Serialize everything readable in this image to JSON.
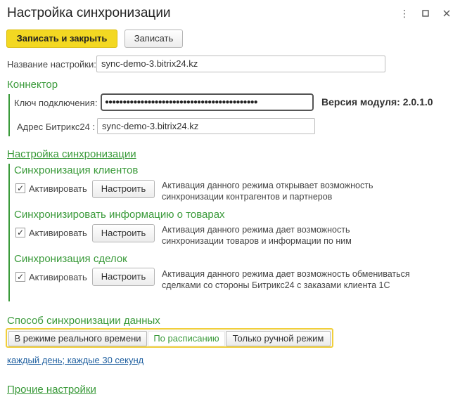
{
  "window": {
    "title": "Настройка синхронизации",
    "menu_icon": "more-vertical-icon",
    "maximize_icon": "maximize-icon",
    "close_icon": "close-icon"
  },
  "toolbar": {
    "save_close_label": "Записать и закрыть",
    "save_label": "Записать"
  },
  "settings_name": {
    "label": "Название настройки:",
    "value": "sync-demo-3.bitrix24.kz"
  },
  "connector": {
    "heading": "Коннектор",
    "key_label": "Ключ подключения:",
    "key_value": "●●●●●●●●●●●●●●●●●●●●●●●●●●●●●●●●●●●●●●●●●●●",
    "module_version": "Версия модуля: 2.0.1.0",
    "address_label": "Адрес Битрикс24 :",
    "address_value": "sync-demo-3.bitrix24.kz"
  },
  "sync_settings": {
    "heading": "Настройка синхронизации",
    "blocks": [
      {
        "title": "Синхронизация клиентов",
        "checkbox_label": "Активировать",
        "checked": true,
        "button_label": "Настроить",
        "desc_line1": "Активация данного режима открывает возможность",
        "desc_line2": "синхронизации контрагентов и партнеров"
      },
      {
        "title": "Синхронизировать информацию о товарах",
        "checkbox_label": "Активировать",
        "checked": true,
        "button_label": "Настроить",
        "desc_line1": "Активация данного режима дает возможность",
        "desc_line2": "синхронизации товаров и информации по ним"
      },
      {
        "title": "Синхронизация сделок",
        "checkbox_label": "Активировать",
        "checked": true,
        "button_label": "Настроить",
        "desc_line1": "Активация данного режима дает возможность обмениваться",
        "desc_line2": "сделками со стороны Битрикс24 с заказами клиента 1С"
      }
    ]
  },
  "sync_method": {
    "heading": "Способ синхронизации данных",
    "options": [
      "В режиме реального времени",
      "По расписанию",
      "Только ручной режим"
    ],
    "selected": "По расписанию",
    "schedule_link": "каждый день; каждые 30 секунд"
  },
  "other": {
    "heading": "Прочие настройки"
  },
  "colors": {
    "accent_green": "#3a9a3a",
    "primary_yellow": "#f3d822",
    "link_blue": "#2060a0"
  }
}
